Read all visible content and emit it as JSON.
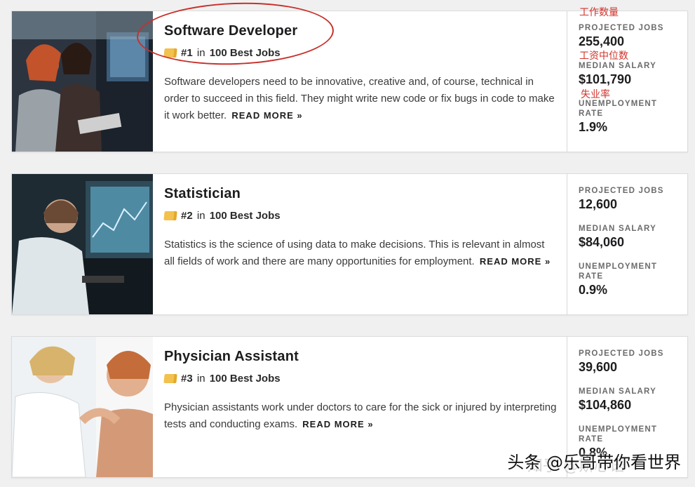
{
  "annotations": {
    "projected_jobs_cn": "工作数量",
    "median_salary_cn": "工资中位数",
    "unemployment_cn": "失业率"
  },
  "watermark": {
    "text": "头条 @乐哥带你看世界",
    "faded_text": "知乎 @斯心语"
  },
  "jobs": [
    {
      "title": "Software Developer",
      "rank": "#1",
      "in_text": "in",
      "list_name": "100 Best Jobs",
      "description": "Software developers need to be innovative, creative and, of course, technical in order to succeed in this field. They might write new code or fix bugs in code to make it work better.",
      "read_more": "READ MORE »",
      "projected_jobs_label": "PROJECTED JOBS",
      "projected_jobs": "255,400",
      "median_salary_label": "MEDIAN SALARY",
      "median_salary": "$101,790",
      "unemployment_label": "UNEMPLOYMENT RATE",
      "unemployment_rate": "1.9%"
    },
    {
      "title": "Statistician",
      "rank": "#2",
      "in_text": "in",
      "list_name": "100 Best Jobs",
      "description": "Statistics is the science of using data to make decisions. This is relevant in almost all fields of work and there are many opportunities for employment.",
      "read_more": "READ MORE »",
      "projected_jobs_label": "PROJECTED JOBS",
      "projected_jobs": "12,600",
      "median_salary_label": "MEDIAN SALARY",
      "median_salary": "$84,060",
      "unemployment_label": "UNEMPLOYMENT RATE",
      "unemployment_rate": "0.9%"
    },
    {
      "title": "Physician Assistant",
      "rank": "#3",
      "in_text": "in",
      "list_name": "100 Best Jobs",
      "description": "Physician assistants work under doctors to care for the sick or injured by interpreting tests and conducting exams.",
      "read_more": "READ MORE »",
      "projected_jobs_label": "PROJECTED JOBS",
      "projected_jobs": "39,600",
      "median_salary_label": "MEDIAN SALARY",
      "median_salary": "$104,860",
      "unemployment_label": "UNEMPLOYMENT RATE",
      "unemployment_rate": "0.8%"
    }
  ]
}
